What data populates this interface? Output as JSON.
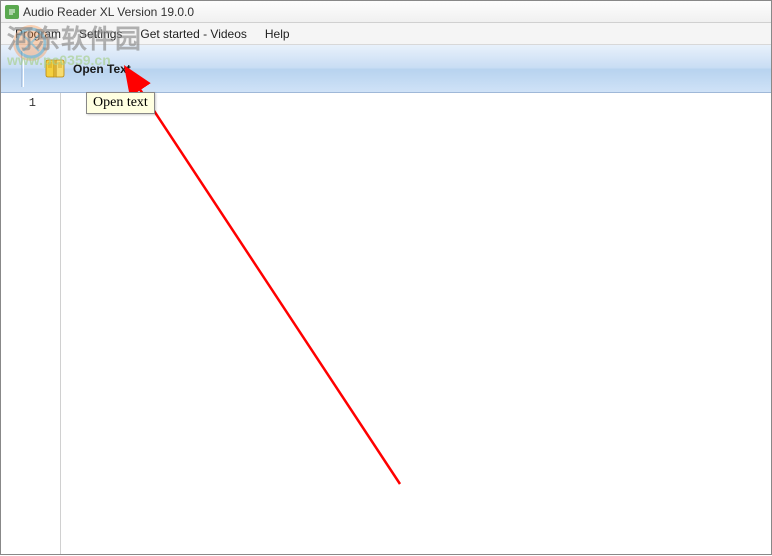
{
  "titlebar": {
    "title": "Audio Reader XL Version 19.0.0"
  },
  "menubar": {
    "items": [
      {
        "label": "Program"
      },
      {
        "label": "Settings"
      },
      {
        "label": "Get started - Videos"
      },
      {
        "label": "Help"
      }
    ]
  },
  "toolbar": {
    "open_text_label": "Open Text"
  },
  "tooltip": {
    "text": "Open text"
  },
  "editor": {
    "line_number": "1"
  },
  "watermark": {
    "cn": "河东软件园",
    "url": "www.pc0359.cn"
  }
}
